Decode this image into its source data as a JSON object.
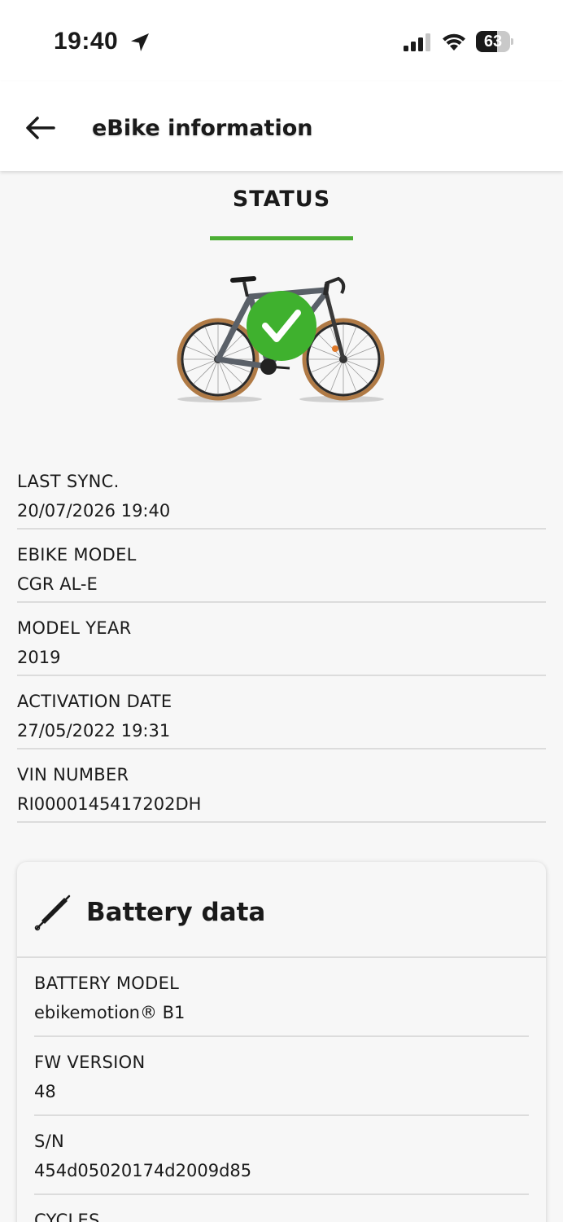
{
  "status_bar": {
    "time": "19:40",
    "battery_percent": 63,
    "battery_label": "63",
    "icons": [
      "location-arrow-icon",
      "cellular-signal-icon",
      "wifi-icon",
      "battery-icon"
    ]
  },
  "header": {
    "title": "eBike information",
    "back_icon": "back-arrow-icon"
  },
  "tab": {
    "label": "STATUS",
    "accent_color": "#4caf35"
  },
  "bike_image": {
    "status_icon": "check-badge-icon",
    "status_color": "#3fb12e"
  },
  "info": [
    {
      "label": "LAST SYNC.",
      "value": "20/07/2026 19:40"
    },
    {
      "label": "EBIKE MODEL",
      "value": "CGR AL-E"
    },
    {
      "label": "MODEL YEAR",
      "value": "2019"
    },
    {
      "label": "ACTIVATION DATE",
      "value": "27/05/2022 19:31"
    },
    {
      "label": "VIN NUMBER",
      "value": "RI0000145417202DH"
    }
  ],
  "battery_card": {
    "title": "Battery data",
    "icon": "pump-icon",
    "rows": [
      {
        "label": "BATTERY MODEL",
        "value": "ebikemotion® B1"
      },
      {
        "label": "FW VERSION",
        "value": "48"
      },
      {
        "label": "S/N",
        "value": "454d05020174d2009d85"
      },
      {
        "label": "CYCLES",
        "value": ""
      }
    ]
  }
}
